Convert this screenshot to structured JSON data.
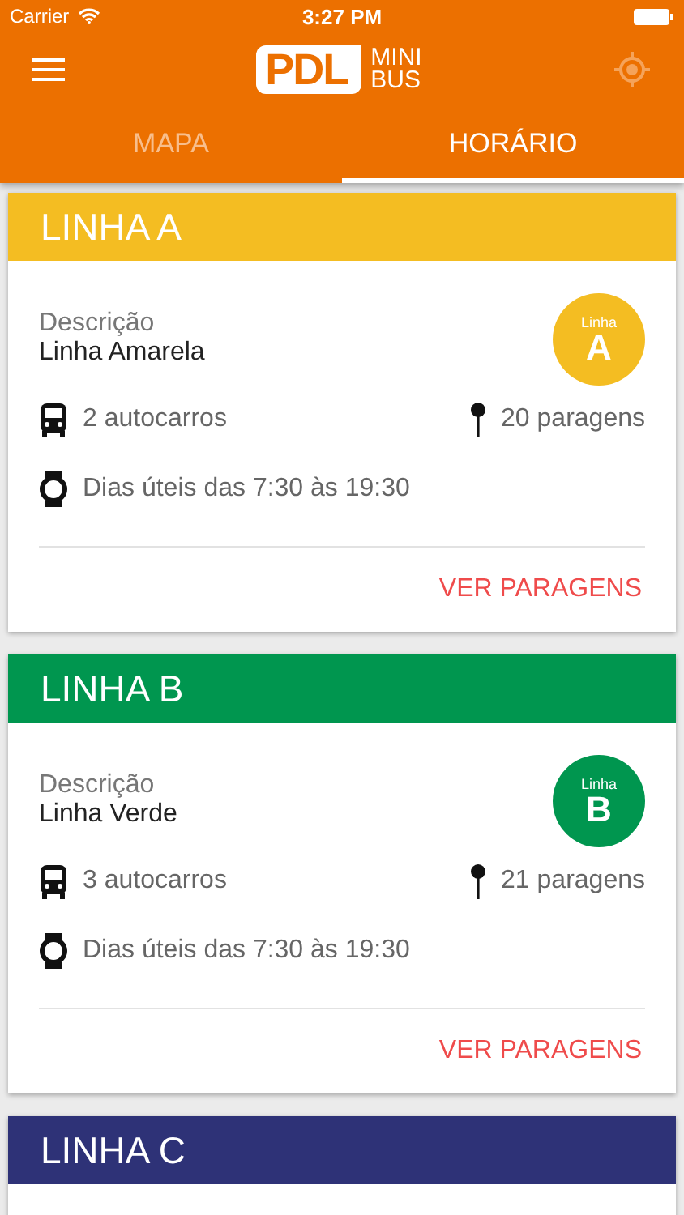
{
  "status_bar": {
    "carrier": "Carrier",
    "time": "3:27 PM"
  },
  "nav": {
    "logo_main": "PDL",
    "logo_top": "MINI",
    "logo_bottom": "BUS"
  },
  "tabs": [
    {
      "label": "MAPA",
      "selected": false
    },
    {
      "label": "HORÁRIO",
      "selected": true
    }
  ],
  "lines": [
    {
      "title": "LINHA A",
      "color": "#f4bd22",
      "description_label": "Descrição",
      "description": "Linha Amarela",
      "badge_label": "Linha",
      "badge_letter": "A",
      "buses": "2 autocarros",
      "stops": "20 paragens",
      "schedule": "Dias úteis das 7:30 às 19:30",
      "action": "VER PARAGENS"
    },
    {
      "title": "LINHA B",
      "color": "#00964f",
      "description_label": "Descrição",
      "description": "Linha Verde",
      "badge_label": "Linha",
      "badge_letter": "B",
      "buses": "3 autocarros",
      "stops": "21 paragens",
      "schedule": "Dias úteis das 7:30 às 19:30",
      "action": "VER PARAGENS"
    },
    {
      "title": "LINHA C",
      "color": "#2e3277"
    }
  ]
}
